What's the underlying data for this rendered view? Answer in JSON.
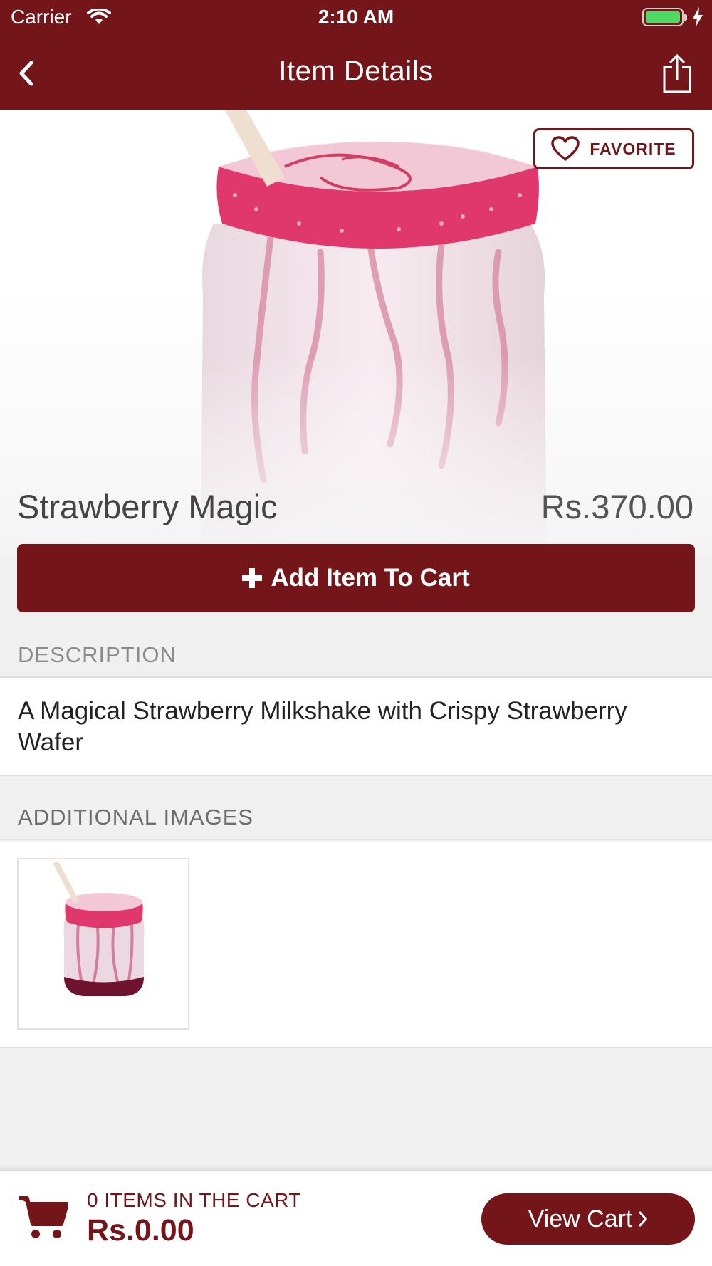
{
  "status_bar": {
    "carrier": "Carrier",
    "time": "2:10 AM"
  },
  "nav": {
    "title": "Item Details"
  },
  "item": {
    "favorite_label": "FAVORITE",
    "name": "Strawberry Magic",
    "price": "Rs.370.00",
    "add_to_cart_label": "Add Item To Cart"
  },
  "description": {
    "header": "DESCRIPTION",
    "text": "A Magical Strawberry Milkshake with Crispy Strawberry Wafer"
  },
  "additional_images": {
    "header": "ADDITIONAL IMAGES"
  },
  "cart": {
    "count_label": "0 ITEMS IN THE CART",
    "total": "Rs.0.00",
    "view_cart_label": "View Cart"
  },
  "colors": {
    "brand": "#74151a",
    "battery": "#4cd964"
  }
}
